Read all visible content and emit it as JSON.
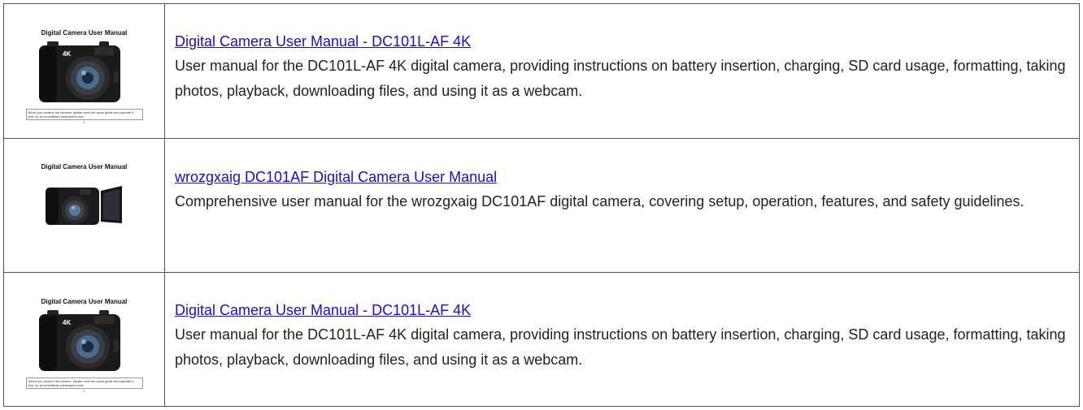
{
  "results": [
    {
      "thumb": {
        "title": "Digital Camera User Manual",
        "badge": "4K",
        "note": "When you receive the camera, please read the quick guide and operate it first, so as to facilitate subsequent use!",
        "page": "1"
      },
      "title": "Digital Camera User Manual - DC101L-AF 4K",
      "description": "User manual for the DC101L-AF 4K digital camera, providing instructions on battery insertion, charging, SD card usage, formatting, taking photos, playback, downloading files, and using it as a webcam."
    },
    {
      "thumb": {
        "title": "Digital Camera User Manual"
      },
      "title": "wrozgxaig DC101AF Digital Camera User Manual",
      "description": "Comprehensive user manual for the wrozgxaig DC101AF digital camera, covering setup, operation, features, and safety guidelines."
    },
    {
      "thumb": {
        "title": "Digital Camera User Manual",
        "badge": "4K",
        "note": "When you receive the camera, please read the quick guide and operate it first, so as to facilitate subsequent use!",
        "page": "1"
      },
      "title": "Digital Camera User Manual - DC101L-AF 4K",
      "description": "User manual for the DC101L-AF 4K digital camera, providing instructions on battery insertion, charging, SD card usage, formatting, taking photos, playback, downloading files, and using it as a webcam."
    }
  ],
  "colors": {
    "link": "#1a0dcc",
    "text": "#222222",
    "border": "#555555"
  }
}
